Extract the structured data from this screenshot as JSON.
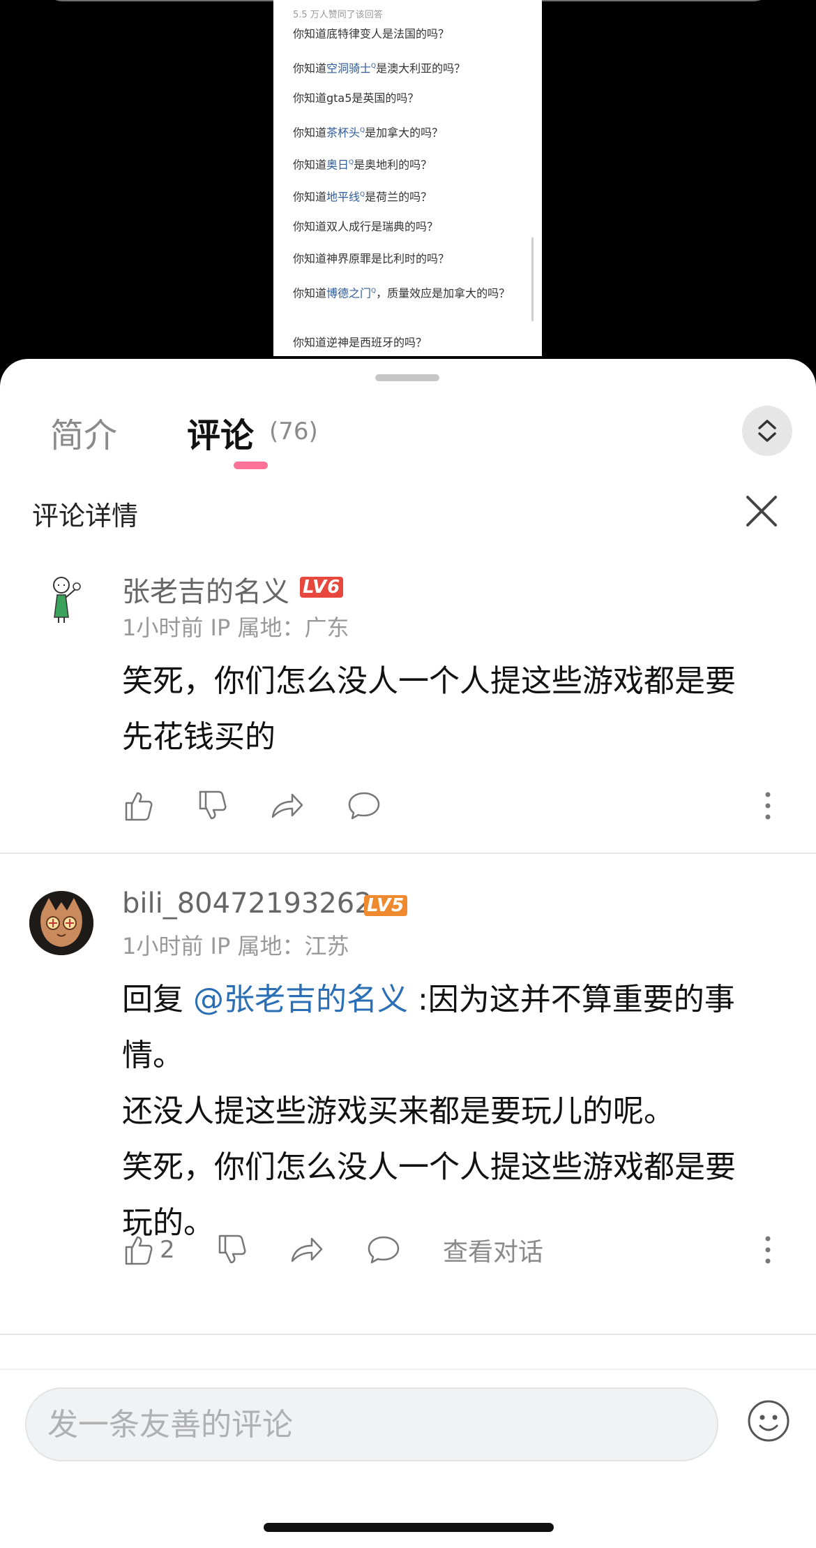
{
  "video": {
    "meta": "5.5 万人赞同了该回答",
    "lines": [
      {
        "pre": "你知道底特律变人是法国的吗？",
        "link": "",
        "post": ""
      },
      {
        "pre": "你知道",
        "link": "空洞骑士",
        "post": "是澳大利亚的吗？"
      },
      {
        "pre": "你知道gta5是英国的吗？",
        "link": "",
        "post": ""
      },
      {
        "pre": "你知道",
        "link": "茶杯头",
        "post": "是加拿大的吗？"
      },
      {
        "pre": "你知道",
        "link": "奥日",
        "post": "是奥地利的吗？"
      },
      {
        "pre": "你知道",
        "link": "地平线",
        "post": "是荷兰的吗？"
      },
      {
        "pre": "你知道双人成行是瑞典的吗？",
        "link": "",
        "post": ""
      },
      {
        "pre": "你知道神界原罪是比利时的吗？",
        "link": "",
        "post": ""
      },
      {
        "pre": "你知道",
        "link": "博德之门",
        "post": "，质量效应是加拿大的吗？"
      },
      {
        "pre": "你知道逆神是西班牙的吗？",
        "link": "",
        "post": ""
      }
    ],
    "link_marker": "Q"
  },
  "tabs": {
    "intro": "简介",
    "comments": "评论",
    "count": "(76)"
  },
  "detail": {
    "title": "评论详情"
  },
  "comments": [
    {
      "user": "张老吉的名义",
      "level": "LV6",
      "time": "1小时前",
      "ip": "IP 属地：广东",
      "lines": [
        "笑死，你们怎么没人一个人提这些游戏都是要",
        "先花钱买的"
      ],
      "likes": ""
    },
    {
      "user": "bili_80472193262",
      "level": "LV5",
      "time": "1小时前",
      "ip": "IP 属地：江苏",
      "reply_prefix": "回复 ",
      "mention": "@张老吉的名义",
      "reply_rest": " :因为这并不算重要的事",
      "lines": [
        "情。",
        "还没人提这些游戏买来都是要玩儿的呢。",
        "笑死，你们怎么没人一个人提这些游戏都是要",
        "玩的。"
      ],
      "likes": "2",
      "view_conversation": "查看对话"
    }
  ],
  "input": {
    "placeholder": "发一条友善的评论"
  },
  "colors": {
    "accent_pink": "#fb7299",
    "lv6": "#e8473e",
    "lv5": "#f08a2e",
    "mention": "#2a6fb5"
  },
  "icons": [
    "thumbs-up-icon",
    "thumbs-down-icon",
    "share-icon",
    "comment-icon",
    "more-icon",
    "close-icon",
    "expand-collapse-icon",
    "emoji-icon"
  ]
}
